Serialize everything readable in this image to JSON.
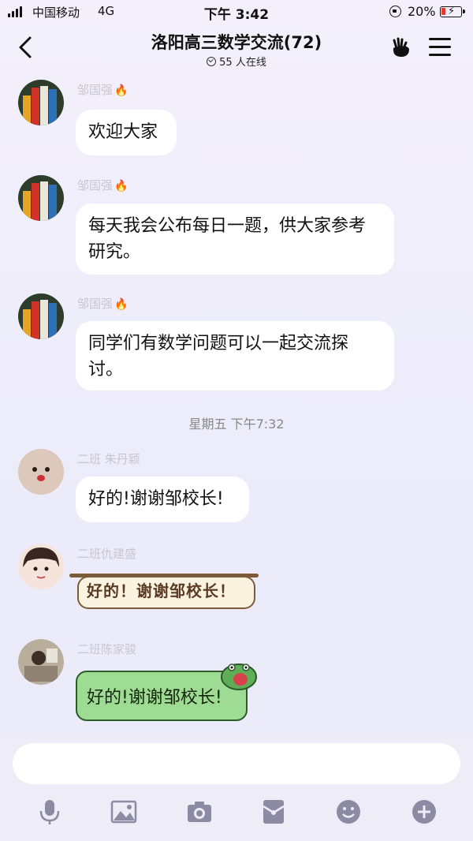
{
  "status_bar": {
    "carrier": "中国移动",
    "network": "4G",
    "time": "下午 3:42",
    "battery_percent": "20%",
    "battery_level": 0.2
  },
  "header": {
    "title": "洛阳高三数学交流(72)",
    "online": "55 人在线"
  },
  "messages": [
    {
      "sender": "邹国强",
      "text": "欢迎大家"
    },
    {
      "sender": "邹国强",
      "text": "每天我会公布每日一题，供大家参考研究。"
    },
    {
      "sender": "邹国强",
      "text": "同学们有数学问题可以一起交流探讨。"
    }
  ],
  "divider": {
    "time": "星期五 下午7:32"
  },
  "replies": [
    {
      "sender": "二班 朱丹颖",
      "text": "好的!谢谢邹校长!"
    },
    {
      "sender": "二班仇建盛",
      "text": "好的！谢谢邹校长！"
    },
    {
      "sender": "二班陈家骏",
      "text": "好的!谢谢邹校长!"
    }
  ],
  "composer": {
    "placeholder": ""
  },
  "toolbar": {
    "icons": [
      "microphone-icon",
      "image-icon",
      "camera-icon",
      "red-packet-icon",
      "emoji-icon",
      "plus-icon"
    ]
  },
  "colors": {
    "background": "#ecebfa",
    "bubble": "#ffffff",
    "green_bubble": "#9fdc93",
    "fire": "#f05a1f"
  }
}
